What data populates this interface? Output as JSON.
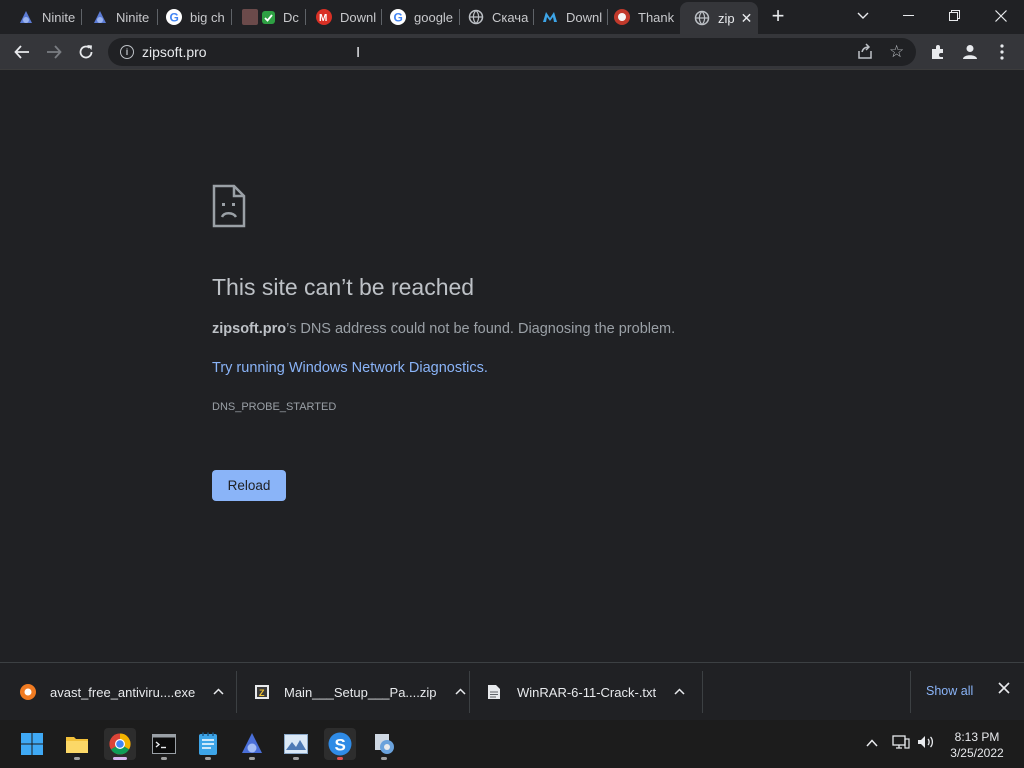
{
  "tabs": [
    {
      "title": "Nin⁠ite",
      "display": "Ninite",
      "icon": "ninite-icon"
    },
    {
      "display": "Ninite",
      "icon": "ninite-icon"
    },
    {
      "display": "big ch",
      "icon": "google-icon"
    },
    {
      "display": "Dc",
      "icon": "app-icon"
    },
    {
      "display": "Downl",
      "icon": "gmail-icon"
    },
    {
      "display": "google",
      "icon": "google-icon"
    },
    {
      "display": "Скача",
      "icon": "globe-icon"
    },
    {
      "display": "Downl",
      "icon": "malwarebytes-icon"
    },
    {
      "display": "Thank",
      "icon": "avast-icon"
    },
    {
      "display": "zip",
      "icon": "globe-icon"
    }
  ],
  "omnibox": {
    "url": "zipsoft.pro"
  },
  "error": {
    "title": "This site can’t be reached",
    "domain": "zipsoft.pro",
    "description": "’s DNS address could not be found. Diagnosing the problem.",
    "link": "Try running Windows Network Diagnostics.",
    "code": "DNS_PROBE_STARTED",
    "reload": "Reload"
  },
  "downloads": [
    {
      "name": "avast_free_antiviru....exe",
      "icon": "avast-icon"
    },
    {
      "name": "Main___Setup___Pa....zip",
      "icon": "zip-icon"
    },
    {
      "name": "WinRAR-6-11-Crack-.txt",
      "icon": "text-file-icon"
    }
  ],
  "downloads_bar": {
    "show_all": "Show all"
  },
  "clock": {
    "time": "8:13 PM",
    "date": "3/25/2022"
  }
}
